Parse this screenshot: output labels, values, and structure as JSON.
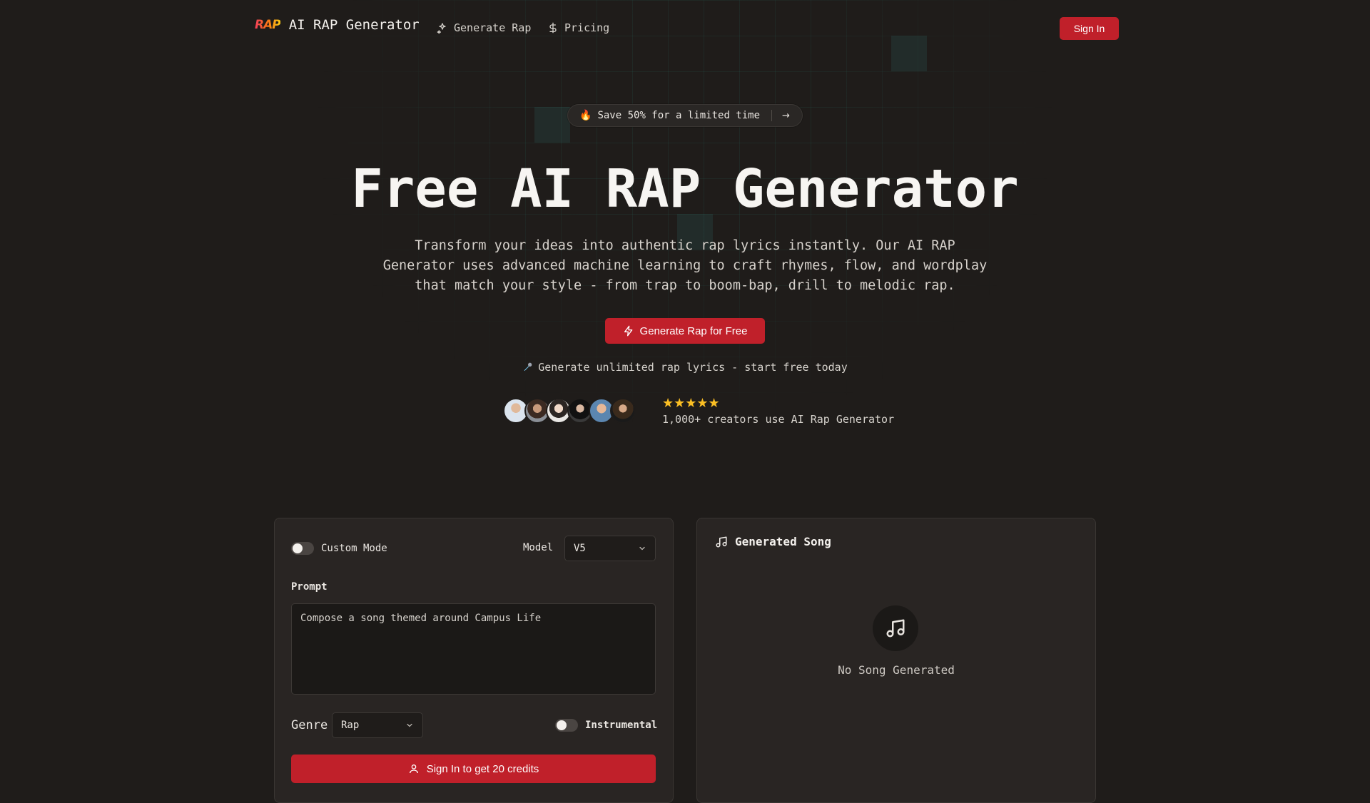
{
  "header": {
    "logo_mark": "RAP",
    "app_title": "AI RAP Generator",
    "nav": [
      {
        "label": "Generate Rap",
        "icon": "sparkles-icon"
      },
      {
        "label": "Pricing",
        "icon": "dollar-icon"
      }
    ],
    "signin_label": "Sign In"
  },
  "promo": {
    "icon": "🔥",
    "text": "Save 50% for a limited time",
    "arrow": "→"
  },
  "hero": {
    "title": "Free AI RAP Generator",
    "subtitle_lines": [
      "Transform your ideas into authentic rap lyrics instantly. Our AI RAP",
      "Generator uses advanced machine learning to craft rhymes, flow, and wordplay",
      "that match your style - from trap to boom-bap, drill to melodic rap."
    ],
    "cta_label": "Generate Rap for Free",
    "unlimited_text": "Generate unlimited rap lyrics - start free today",
    "stars": "★★★★★",
    "creators_text": "1,000+ creators use AI Rap Generator"
  },
  "form": {
    "custom_mode_label": "Custom Mode",
    "model_label": "Model",
    "model_value": "V5",
    "prompt_label": "Prompt",
    "prompt_value": "Compose a song themed around Campus Life",
    "genre_label": "Genre",
    "genre_value": "Rap",
    "instrumental_label": "Instrumental",
    "submit_label": "Sign In to get 20 credits"
  },
  "song_panel": {
    "title": "Generated Song",
    "empty_text": "No Song Generated"
  },
  "colors": {
    "background": "#1f1c1a",
    "accent": "#c0202a",
    "card": "#292523",
    "star": "#fbbf24"
  }
}
